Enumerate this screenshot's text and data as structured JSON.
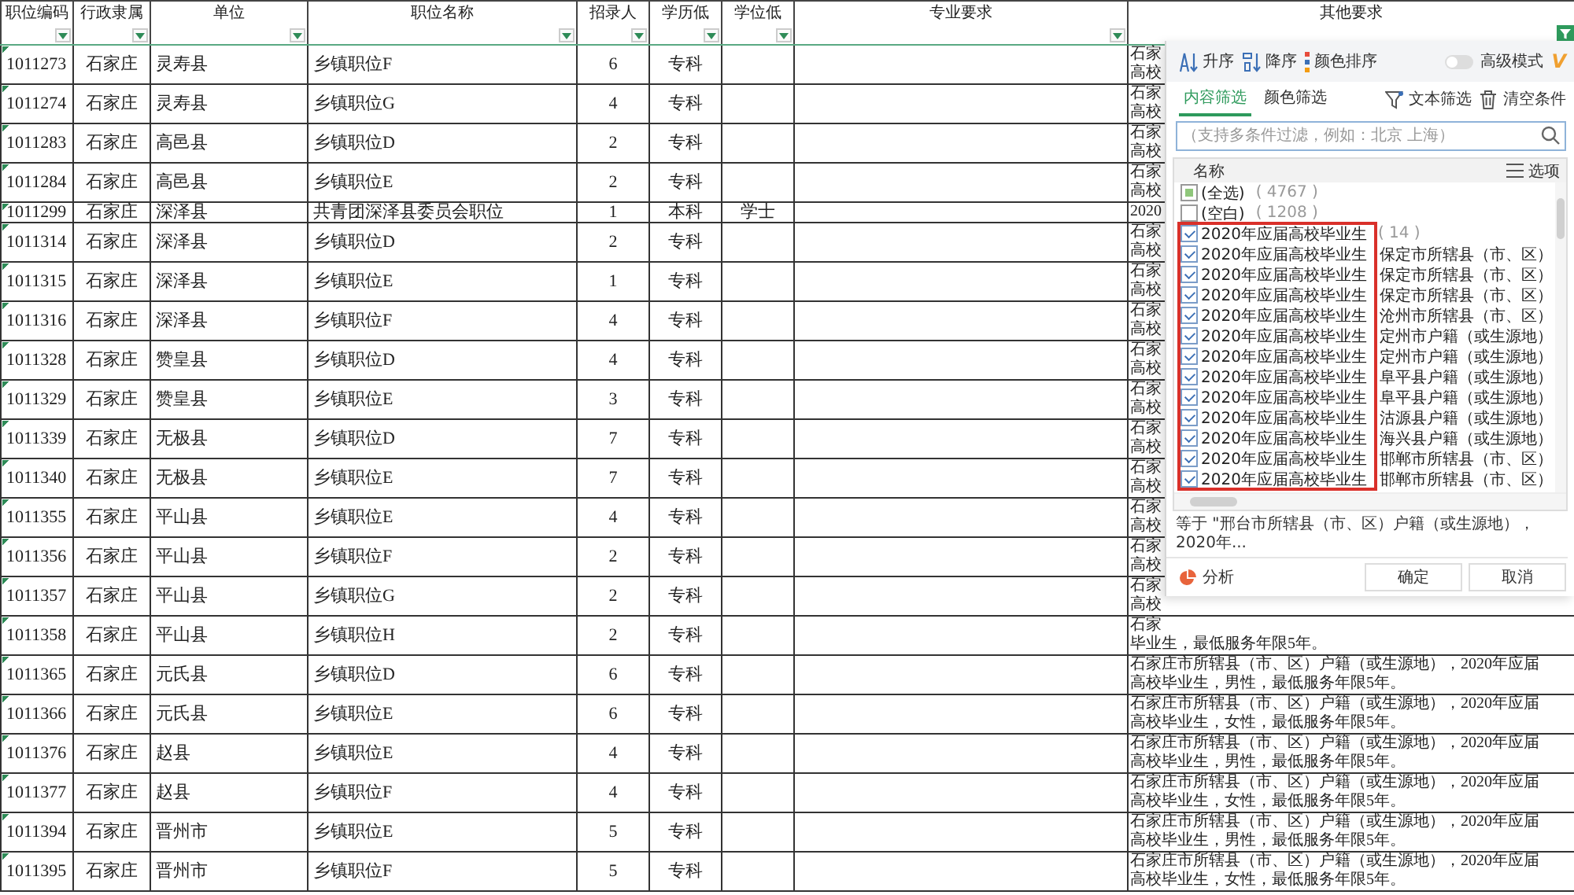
{
  "sheet": {
    "columns": [
      {
        "label": "职位编码",
        "filter_applied": false
      },
      {
        "label": "行政隶属",
        "filter_applied": false
      },
      {
        "label": "单位",
        "filter_applied": false
      },
      {
        "label": "职位名称",
        "filter_applied": false
      },
      {
        "label": "招录人",
        "filter_applied": false
      },
      {
        "label": "学历低",
        "filter_applied": false
      },
      {
        "label": "学位低",
        "filter_applied": false
      },
      {
        "label": "专业要求",
        "filter_applied": false
      },
      {
        "label": "其他要求",
        "filter_applied": true
      }
    ],
    "rows": [
      {
        "cells": [
          "1011273",
          "石家庄",
          "灵寿县",
          "乡镇职位F",
          "6",
          "专科",
          "",
          ""
        ],
        "other": [
          "石家",
          "高校"
        ]
      },
      {
        "cells": [
          "1011274",
          "石家庄",
          "灵寿县",
          "乡镇职位G",
          "4",
          "专科",
          "",
          ""
        ],
        "other": [
          "石家",
          "高校"
        ]
      },
      {
        "cells": [
          "1011283",
          "石家庄",
          "高邑县",
          "乡镇职位D",
          "2",
          "专科",
          "",
          ""
        ],
        "other": [
          "石家",
          "高校"
        ]
      },
      {
        "cells": [
          "1011284",
          "石家庄",
          "高邑县",
          "乡镇职位E",
          "2",
          "专科",
          "",
          ""
        ],
        "other": [
          "石家",
          "高校"
        ]
      },
      {
        "cells": [
          "1011299",
          "石家庄",
          "深泽县",
          "共青团深泽县委员会职位",
          "1",
          "本科",
          "学士",
          ""
        ],
        "other": [
          "2020"
        ]
      },
      {
        "cells": [
          "1011314",
          "石家庄",
          "深泽县",
          "乡镇职位D",
          "2",
          "专科",
          "",
          ""
        ],
        "other": [
          "石家",
          "高校"
        ]
      },
      {
        "cells": [
          "1011315",
          "石家庄",
          "深泽县",
          "乡镇职位E",
          "1",
          "专科",
          "",
          ""
        ],
        "other": [
          "石家",
          "高校"
        ]
      },
      {
        "cells": [
          "1011316",
          "石家庄",
          "深泽县",
          "乡镇职位F",
          "4",
          "专科",
          "",
          ""
        ],
        "other": [
          "石家",
          "高校"
        ]
      },
      {
        "cells": [
          "1011328",
          "石家庄",
          "赞皇县",
          "乡镇职位D",
          "4",
          "专科",
          "",
          ""
        ],
        "other": [
          "石家",
          "高校"
        ]
      },
      {
        "cells": [
          "1011329",
          "石家庄",
          "赞皇县",
          "乡镇职位E",
          "3",
          "专科",
          "",
          ""
        ],
        "other": [
          "石家",
          "高校"
        ]
      },
      {
        "cells": [
          "1011339",
          "石家庄",
          "无极县",
          "乡镇职位D",
          "7",
          "专科",
          "",
          ""
        ],
        "other": [
          "石家",
          "高校"
        ]
      },
      {
        "cells": [
          "1011340",
          "石家庄",
          "无极县",
          "乡镇职位E",
          "7",
          "专科",
          "",
          ""
        ],
        "other": [
          "石家",
          "高校"
        ]
      },
      {
        "cells": [
          "1011355",
          "石家庄",
          "平山县",
          "乡镇职位E",
          "4",
          "专科",
          "",
          ""
        ],
        "other": [
          "石家",
          "高校"
        ]
      },
      {
        "cells": [
          "1011356",
          "石家庄",
          "平山县",
          "乡镇职位F",
          "2",
          "专科",
          "",
          ""
        ],
        "other": [
          "石家",
          "高校"
        ]
      },
      {
        "cells": [
          "1011357",
          "石家庄",
          "平山县",
          "乡镇职位G",
          "2",
          "专科",
          "",
          ""
        ],
        "other": [
          "石家",
          "高校"
        ]
      },
      {
        "cells": [
          "1011358",
          "石家庄",
          "平山县",
          "乡镇职位H",
          "2",
          "专科",
          "",
          ""
        ],
        "other": [
          "石家",
          "毕业生，最低服务年限5年。"
        ]
      },
      {
        "cells": [
          "1011365",
          "石家庄",
          "元氏县",
          "乡镇职位D",
          "6",
          "专科",
          "",
          ""
        ],
        "other": [
          "石家庄市所辖县（市、区）户籍（或生源地），2020年应届",
          "高校毕业生，男性，最低服务年限5年。"
        ]
      },
      {
        "cells": [
          "1011366",
          "石家庄",
          "元氏县",
          "乡镇职位E",
          "6",
          "专科",
          "",
          ""
        ],
        "other": [
          "石家庄市所辖县（市、区）户籍（或生源地），2020年应届",
          "高校毕业生，女性，最低服务年限5年。"
        ]
      },
      {
        "cells": [
          "1011376",
          "石家庄",
          "赵县",
          "乡镇职位E",
          "4",
          "专科",
          "",
          ""
        ],
        "other": [
          "石家庄市所辖县（市、区）户籍（或生源地），2020年应届",
          "高校毕业生，男性，最低服务年限5年。"
        ]
      },
      {
        "cells": [
          "1011377",
          "石家庄",
          "赵县",
          "乡镇职位F",
          "4",
          "专科",
          "",
          ""
        ],
        "other": [
          "石家庄市所辖县（市、区）户籍（或生源地），2020年应届",
          "高校毕业生，女性，最低服务年限5年。"
        ]
      },
      {
        "cells": [
          "1011394",
          "石家庄",
          "晋州市",
          "乡镇职位E",
          "5",
          "专科",
          "",
          ""
        ],
        "other": [
          "石家庄市所辖县（市、区）户籍（或生源地），2020年应届",
          "高校毕业生，男性，最低服务年限5年。"
        ]
      },
      {
        "cells": [
          "1011395",
          "石家庄",
          "晋州市",
          "乡镇职位F",
          "5",
          "专科",
          "",
          ""
        ],
        "other": [
          "石家庄市所辖县（市、区）户籍（或生源地），2020年应届",
          "高校毕业生，女性，最低服务年限5年。"
        ]
      }
    ]
  },
  "filter_popup": {
    "sort_buttons": [
      "升序",
      "降序",
      "颜色排序"
    ],
    "advanced_mode": {
      "label": "高级模式",
      "on": false
    },
    "vip_badge": "V",
    "tabs": [
      {
        "label": "内容筛选",
        "selected": true
      },
      {
        "label": "颜色筛选",
        "selected": false
      }
    ],
    "actions": [
      "文本筛选",
      "清空条件"
    ],
    "search": {
      "placeholder": "（支持多条件过滤，例如：北京 上海）"
    },
    "list": {
      "header": "名称",
      "options": "选项",
      "items": [
        {
          "label": "(全选)",
          "count": "( 4767 )",
          "checked": false,
          "mixed": true
        },
        {
          "label": "(空白)",
          "count": "( 1208 )",
          "checked": false,
          "mixed": false
        },
        {
          "label": "2020年应届高校毕业生",
          "count": "( 14 )",
          "checked": true,
          "mixed": false
        },
        {
          "label": "2020年应届高校毕业生",
          "detail": "保定市所辖县（市、区）",
          "checked": true,
          "mixed": false
        },
        {
          "label": "2020年应届高校毕业生",
          "detail": "保定市所辖县（市、区）",
          "checked": true,
          "mixed": false
        },
        {
          "label": "2020年应届高校毕业生",
          "detail": "保定市所辖县（市、区）",
          "checked": true,
          "mixed": false
        },
        {
          "label": "2020年应届高校毕业生",
          "detail": "沧州市所辖县（市、区）",
          "checked": true,
          "mixed": false
        },
        {
          "label": "2020年应届高校毕业生",
          "detail": "定州市户籍（或生源地）",
          "checked": true,
          "mixed": false
        },
        {
          "label": "2020年应届高校毕业生",
          "detail": "定州市户籍（或生源地）",
          "checked": true,
          "mixed": false
        },
        {
          "label": "2020年应届高校毕业生",
          "detail": "阜平县户籍（或生源地）",
          "checked": true,
          "mixed": false
        },
        {
          "label": "2020年应届高校毕业生",
          "detail": "阜平县户籍（或生源地）",
          "checked": true,
          "mixed": false
        },
        {
          "label": "2020年应届高校毕业生",
          "detail": "沽源县户籍（或生源地）",
          "checked": true,
          "mixed": false
        },
        {
          "label": "2020年应届高校毕业生",
          "detail": "海兴县户籍（或生源地）",
          "checked": true,
          "mixed": false
        },
        {
          "label": "2020年应届高校毕业生",
          "detail": "邯郸市所辖县（市、区）",
          "checked": true,
          "mixed": false
        },
        {
          "label": "2020年应届高校毕业生",
          "detail": "邯郸市所辖县（市、区）",
          "checked": true,
          "mixed": false
        }
      ]
    },
    "condition": "等于 \"邢台市所辖县（市、区）户籍（或生源地），2020年...",
    "analyze_button": "分析",
    "buttons": [
      "确定",
      "取消"
    ]
  }
}
